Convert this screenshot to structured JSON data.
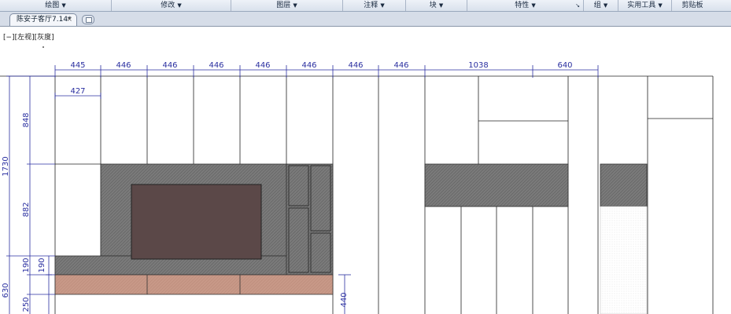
{
  "ribbon": {
    "panels": [
      {
        "label": "绘图"
      },
      {
        "label": "修改"
      },
      {
        "label": "图层"
      },
      {
        "label": "注释"
      },
      {
        "label": "块"
      },
      {
        "label": "特性"
      },
      {
        "label": "组"
      },
      {
        "label": "实用工具"
      },
      {
        "label": "剪贴板"
      }
    ]
  },
  "tabs": {
    "active_label": "陈安子客厅7.14*",
    "close_glyph": "×"
  },
  "viewport": {
    "label": "[−][左视][灰度]"
  },
  "dimensions": {
    "top": [
      "445",
      "446",
      "446",
      "446",
      "446",
      "446",
      "446",
      "446",
      "1038",
      "640"
    ],
    "sub": "427",
    "left": [
      "848",
      "882",
      "190",
      "190",
      "250"
    ],
    "left_total": [
      "1730",
      "630"
    ],
    "right": "440"
  },
  "colors": {
    "wall_panel": "#7a7a7a",
    "tv_screen": "#5b4848",
    "wood_band": "#c79887",
    "dimension": "#2a2fa0",
    "ribbon_bg": "#dde4ee"
  }
}
